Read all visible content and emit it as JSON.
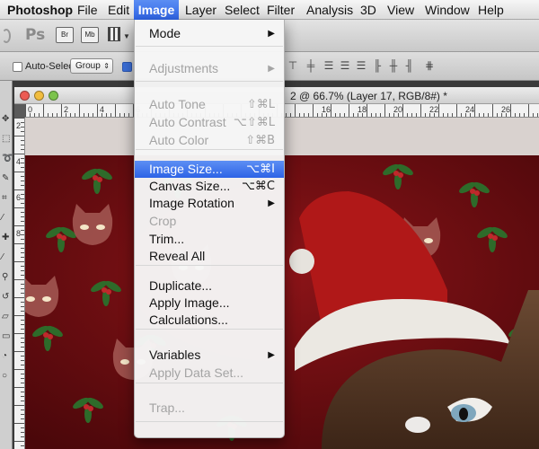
{
  "menubar": {
    "items": [
      "Photoshop",
      "File",
      "Edit",
      "Image",
      "Layer",
      "Select",
      "Filter",
      "Analysis",
      "3D",
      "View",
      "Window",
      "Help"
    ],
    "active_item": "Image"
  },
  "appbar": {
    "logo": "Ps",
    "br_label": "Br",
    "mb_label": "Mb"
  },
  "options": {
    "autoselect_label": "Auto-Select:",
    "group_value": "Group"
  },
  "document": {
    "title_fragment": "2 @ 66.7% (Layer 17, RGB/8#) *",
    "ruler_h": [
      "0",
      "2",
      "4",
      "6",
      "8",
      "10",
      "12",
      "14",
      "16",
      "18",
      "20",
      "22",
      "24",
      "26",
      "28"
    ],
    "ruler_v": [
      "2",
      "4",
      "6",
      "8",
      "1",
      "1",
      "1",
      "1",
      "1"
    ]
  },
  "image_menu": {
    "items": [
      {
        "label": "Mode",
        "shortcut": "",
        "submenu": true,
        "enabled": true
      },
      {
        "label": "Adjustments",
        "shortcut": "",
        "submenu": true,
        "enabled": false
      },
      {
        "label": "Auto Tone",
        "shortcut": "⇧⌘L",
        "submenu": false,
        "enabled": false
      },
      {
        "label": "Auto Contrast",
        "shortcut": "⌥⇧⌘L",
        "submenu": false,
        "enabled": false
      },
      {
        "label": "Auto Color",
        "shortcut": "⇧⌘B",
        "submenu": false,
        "enabled": false
      },
      {
        "label": "Image Size...",
        "shortcut": "⌥⌘I",
        "submenu": false,
        "enabled": true,
        "highlighted": true
      },
      {
        "label": "Canvas Size...",
        "shortcut": "⌥⌘C",
        "submenu": false,
        "enabled": true
      },
      {
        "label": "Image Rotation",
        "shortcut": "",
        "submenu": true,
        "enabled": true
      },
      {
        "label": "Crop",
        "shortcut": "",
        "submenu": false,
        "enabled": false
      },
      {
        "label": "Trim...",
        "shortcut": "",
        "submenu": false,
        "enabled": true
      },
      {
        "label": "Reveal All",
        "shortcut": "",
        "submenu": false,
        "enabled": true
      },
      {
        "label": "Duplicate...",
        "shortcut": "",
        "submenu": false,
        "enabled": true
      },
      {
        "label": "Apply Image...",
        "shortcut": "",
        "submenu": false,
        "enabled": true
      },
      {
        "label": "Calculations...",
        "shortcut": "",
        "submenu": false,
        "enabled": true
      },
      {
        "label": "Variables",
        "shortcut": "",
        "submenu": true,
        "enabled": true
      },
      {
        "label": "Apply Data Set...",
        "shortcut": "",
        "submenu": false,
        "enabled": false
      },
      {
        "label": "Trap...",
        "shortcut": "",
        "submenu": false,
        "enabled": false
      }
    ]
  },
  "colors": {
    "menu_highlight": "#3a6fe9",
    "canvas_red": "#7a1014",
    "holly_green": "#2e6b2a",
    "berry_red": "#c0282b"
  },
  "icons": {
    "submenu_arrow": "triangle-right",
    "traffic_lights": [
      "close",
      "minimize",
      "zoom"
    ]
  }
}
